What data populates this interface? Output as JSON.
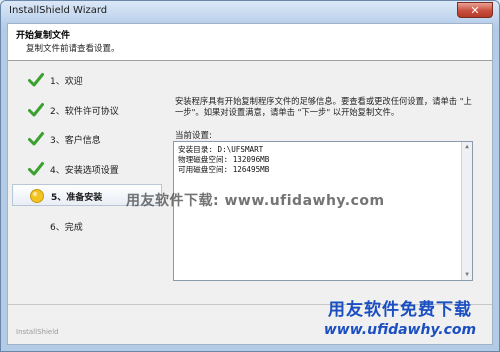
{
  "window": {
    "title": "InstallShield Wizard",
    "close_glyph": "✕"
  },
  "header": {
    "title": "开始复制文件",
    "subtitle": "复制文件前请查看设置。"
  },
  "steps": [
    {
      "label": "1、欢迎",
      "state": "done"
    },
    {
      "label": "2、软件许可协议",
      "state": "done"
    },
    {
      "label": "3、客户信息",
      "state": "done"
    },
    {
      "label": "4、安装选项设置",
      "state": "done"
    },
    {
      "label": "5、准备安装",
      "state": "current"
    },
    {
      "label": "6、完成",
      "state": "pending"
    }
  ],
  "content": {
    "description_line1": "安装程序具有开始复制程序文件的足够信息。要查看或更改任何设置，请单击 \"上",
    "description_line2": "一步\"。如果对设置满意，请单击 \"下一步\" 以开始复制文件。",
    "current_settings_label": "当前设置:",
    "settings": {
      "line1": "安装目录: D:\\UFSMART",
      "line2": "物理磁盘空间: 132096MB",
      "line3": "可用磁盘空间: 126495MB"
    }
  },
  "watermark": {
    "middle": "用友软件下载: www.ufidawhy.com",
    "bottom_line1": "用友软件免费下载",
    "bottom_line2": "www.ufidawhy.com"
  },
  "footer": {
    "brand": "InstallShield"
  },
  "colors": {
    "check": "#3aa12f",
    "current_bullet": "#f2c321",
    "watermark_blue": "#1b4fc1"
  }
}
